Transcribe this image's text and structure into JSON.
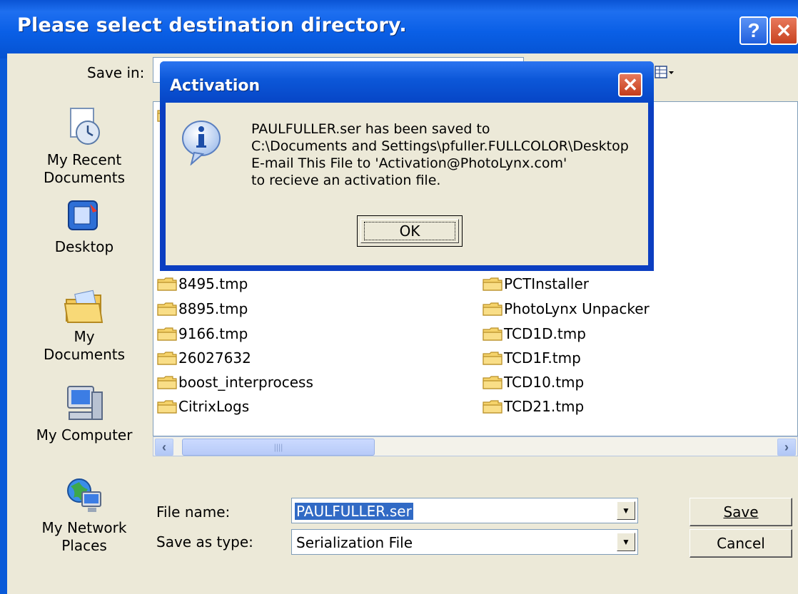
{
  "dialog": {
    "title": "Please select destination directory.",
    "help_icon": "help-icon",
    "close_icon": "close-icon"
  },
  "toolbar": {
    "save_in_label": "Save in:",
    "save_in_value": "",
    "view_icon": "view-menu-icon"
  },
  "places": [
    {
      "label": "My Recent\nDocuments",
      "icon": "recent-documents-icon"
    },
    {
      "label": "Desktop",
      "icon": "desktop-icon"
    },
    {
      "label": "My Documents",
      "icon": "my-documents-icon"
    },
    {
      "label": "My Computer",
      "icon": "my-computer-icon"
    },
    {
      "label": "My Network\nPlaces",
      "icon": "network-places-icon"
    }
  ],
  "files": {
    "left_column": [
      "8495.tmp",
      "8895.tmp",
      "9166.tmp",
      "26027632",
      "boost_interprocess",
      "CitrixLogs"
    ],
    "right_column": [
      "PCTInstaller",
      "PhotoLynx Unpacker",
      "TCD1D.tmp",
      "TCD1F.tmp",
      "TCD10.tmp",
      "TCD21.tmp"
    ]
  },
  "form": {
    "file_name_label": "File name:",
    "file_name_value": "PAULFULLER.ser",
    "save_as_type_label": "Save as type:",
    "save_as_type_value": "Serialization File",
    "save_button": "Save",
    "cancel_button": "Cancel"
  },
  "message_box": {
    "title": "Activation",
    "icon": "information-icon",
    "lines": [
      "PAULFULLER.ser has been saved to",
      "C:\\Documents and Settings\\pfuller.FULLCOLOR\\Desktop",
      "E-mail This File to 'Activation@PhotoLynx.com'",
      "to recieve an activation file."
    ],
    "ok_button": "OK"
  },
  "colors": {
    "title_bar": "#0a5fe6",
    "dialog_face": "#ece9d8",
    "selection": "#316ac5"
  }
}
